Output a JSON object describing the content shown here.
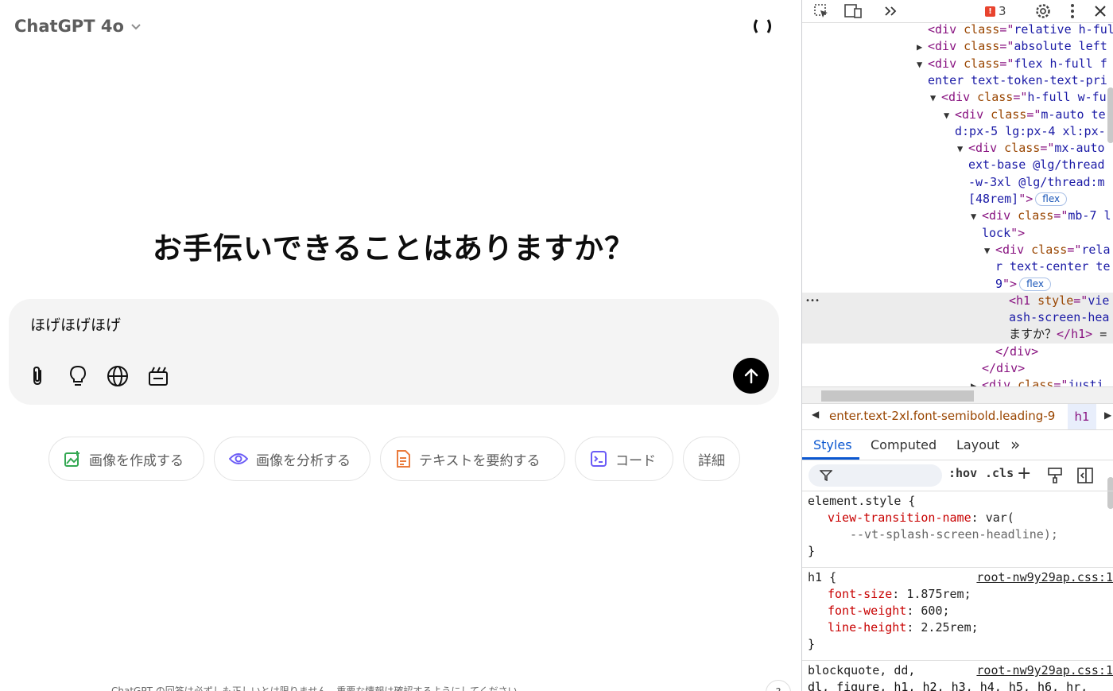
{
  "chat": {
    "model_label": "ChatGPT 4o",
    "headline": "お手伝いできることはありますか？",
    "input_value": "ほげほげほげ",
    "chips": [
      {
        "label": "画像を作成する",
        "icon": "image-create-icon",
        "color": "#34a853"
      },
      {
        "label": "画像を分析する",
        "icon": "eye-icon",
        "color": "#6b5cf6"
      },
      {
        "label": "テキストを要約する",
        "icon": "document-icon",
        "color": "#ea7b3c"
      },
      {
        "label": "コード",
        "icon": "terminal-icon",
        "color": "#6b5cf6"
      },
      {
        "label": "詳細",
        "icon": "",
        "color": "#5d5d5d"
      }
    ],
    "footer_text": "ChatGPT の回答は必ずしも正しいとは限りません。重要な情報は確認するようにしてください。",
    "help_label": "?"
  },
  "devtools": {
    "issues_count": "3",
    "elements": [
      {
        "indent": 1,
        "tri": "",
        "parts": [
          [
            "tag",
            "<div "
          ],
          [
            "attr",
            "class"
          ],
          [
            "tag",
            "=\""
          ],
          [
            "val",
            "relative h-full"
          ]
        ]
      },
      {
        "indent": 1,
        "tri": "▶",
        "parts": [
          [
            "tag",
            "<div "
          ],
          [
            "attr",
            "class"
          ],
          [
            "tag",
            "=\""
          ],
          [
            "val",
            "absolute left"
          ]
        ]
      },
      {
        "indent": 1,
        "tri": "▼",
        "parts": [
          [
            "tag",
            "<div "
          ],
          [
            "attr",
            "class"
          ],
          [
            "tag",
            "=\""
          ],
          [
            "val",
            "flex h-full f"
          ]
        ]
      },
      {
        "indent": 1,
        "tri": "",
        "parts": [
          [
            "val",
            "enter text-token-text-pri"
          ]
        ]
      },
      {
        "indent": 2,
        "tri": "▼",
        "parts": [
          [
            "tag",
            "<div "
          ],
          [
            "attr",
            "class"
          ],
          [
            "tag",
            "=\""
          ],
          [
            "val",
            "h-full w-fu"
          ]
        ]
      },
      {
        "indent": 3,
        "tri": "▼",
        "parts": [
          [
            "tag",
            "<div "
          ],
          [
            "attr",
            "class"
          ],
          [
            "tag",
            "=\""
          ],
          [
            "val",
            "m-auto te"
          ]
        ]
      },
      {
        "indent": 3,
        "tri": "",
        "parts": [
          [
            "val",
            "d:px-5 lg:px-4 xl:px-"
          ]
        ]
      },
      {
        "indent": 4,
        "tri": "▼",
        "parts": [
          [
            "tag",
            "<div "
          ],
          [
            "attr",
            "class"
          ],
          [
            "tag",
            "=\""
          ],
          [
            "val",
            "mx-auto"
          ]
        ]
      },
      {
        "indent": 4,
        "tri": "",
        "parts": [
          [
            "val",
            "ext-base @lg/thread"
          ]
        ]
      },
      {
        "indent": 4,
        "tri": "",
        "parts": [
          [
            "val",
            "-w-3xl @lg/thread:m"
          ]
        ]
      },
      {
        "indent": 4,
        "tri": "",
        "parts": [
          [
            "val",
            "[48rem]"
          ],
          [
            "tag",
            "\">"
          ]
        ],
        "badge": "flex"
      },
      {
        "indent": 5,
        "tri": "▼",
        "parts": [
          [
            "tag",
            "<div "
          ],
          [
            "attr",
            "class"
          ],
          [
            "tag",
            "=\""
          ],
          [
            "val",
            "mb-7 l"
          ]
        ]
      },
      {
        "indent": 5,
        "tri": "",
        "parts": [
          [
            "val",
            "lock"
          ],
          [
            "tag",
            "\">"
          ]
        ]
      },
      {
        "indent": 6,
        "tri": "▼",
        "parts": [
          [
            "tag",
            "<div "
          ],
          [
            "attr",
            "class"
          ],
          [
            "tag",
            "=\""
          ],
          [
            "val",
            "rela"
          ]
        ]
      },
      {
        "indent": 6,
        "tri": "",
        "parts": [
          [
            "val",
            "r text-center te"
          ]
        ]
      },
      {
        "indent": 6,
        "tri": "",
        "parts": [
          [
            "val",
            "9"
          ],
          [
            "tag",
            "\">"
          ]
        ],
        "badge": "flex"
      },
      {
        "indent": 7,
        "tri": "",
        "parts": [
          [
            "tag",
            "<h1 "
          ],
          [
            "attr",
            "style"
          ],
          [
            "tag",
            "=\""
          ],
          [
            "val",
            "vie"
          ]
        ],
        "hl": true
      },
      {
        "indent": 7,
        "tri": "",
        "parts": [
          [
            "val",
            "ash-screen-hea"
          ]
        ],
        "hl": true
      },
      {
        "indent": 7,
        "tri": "",
        "parts": [
          [
            "plain",
            "ますか？"
          ],
          [
            "tag",
            "</h1>"
          ],
          [
            "plain",
            " ="
          ]
        ],
        "hl": true
      },
      {
        "indent": 6,
        "tri": "",
        "parts": [
          [
            "tag",
            "</div>"
          ]
        ]
      },
      {
        "indent": 5,
        "tri": "",
        "parts": [
          [
            "tag",
            "</div>"
          ]
        ]
      },
      {
        "indent": 5,
        "tri": "▶",
        "parts": [
          [
            "tag",
            "<div "
          ],
          [
            "attr",
            "class"
          ],
          [
            "tag",
            "=\""
          ],
          [
            "val",
            "justi"
          ]
        ]
      }
    ],
    "dots_label": "•••",
    "breadcrumb": "enter.text-2xl.font-semibold.leading-9",
    "breadcrumb_tag": "h1",
    "tabs": [
      "Styles",
      "Computed",
      "Layout"
    ],
    "more_tabs": "»",
    "filter_buttons": [
      ":hov",
      ".cls"
    ],
    "rules": [
      {
        "selector": "element.style {",
        "source": "",
        "props": [
          {
            "name": "view-transition-name",
            "value": "var("
          },
          {
            "name": "",
            "value": "--vt-splash-screen-headline);"
          }
        ]
      },
      {
        "selector": "h1 {",
        "source": "root-nw9y29ap.css:1",
        "props": [
          {
            "name": "font-size",
            "value": "1.875rem;"
          },
          {
            "name": "font-weight",
            "value": "600;"
          },
          {
            "name": "line-height",
            "value": "2.25rem;"
          }
        ]
      },
      {
        "selector": "blockquote, dd,",
        "source": "root-nw9y29ap.css:1",
        "props": []
      }
    ],
    "rule_last_line": "dl, figure, h1, h2, h3, h4, h5, h6, hr,"
  }
}
